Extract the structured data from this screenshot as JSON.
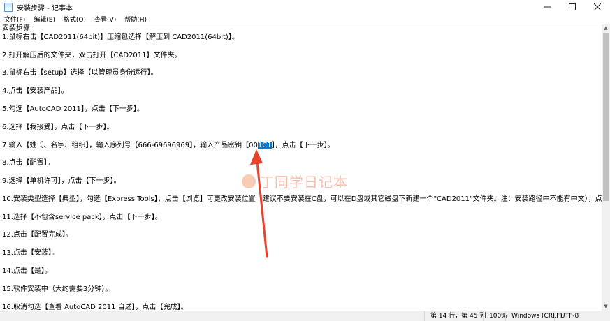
{
  "window": {
    "title": "安装步骤 - 记事本",
    "minimize_icon": "minimize-icon",
    "maximize_icon": "maximize-icon",
    "close_icon": "close-icon"
  },
  "menu": {
    "items": [
      "文件(F)",
      "编辑(E)",
      "格式(O)",
      "查看(V)",
      "帮助(H)"
    ]
  },
  "editor": {
    "lines": [
      "安装步骤",
      "1.鼠标右击【CAD2011(64bit)】压缩包选择【解压到 CAD2011(64bit)】。",
      "",
      "2.打开解压后的文件夹，双击打开【CAD2011】文件夹。",
      "",
      "3.鼠标右击【setup】选择【以管理员身份运行】。",
      "",
      "4.点击【安装产品】。",
      "",
      "5.勾选【AutoCAD 2011】，点击【下一步】。",
      "",
      "6.选择【我接受】，点击【下一步】。",
      "",
      "7.输入【姓氏、名字、组织】，输入序列号【666-69696969】，输入产品密钥【001C1】，点击【下一步】。",
      "",
      "8.点击【配置】。",
      "",
      "9.选择【单机许可】，点击【下一步】。",
      "",
      "10.安装类型选择【典型】，勾选【Express Tools】，点击【浏览】可更改安装位置（建议不要安装在C盘，可以在D盘或其它磁盘下新建一个\"CAD2011\"文件夹。注：安装路径中不能有中文），点",
      "",
      "11.选择【不包含service pack】，点击【下一步】。",
      "",
      "12.点击【配置完成】。",
      "",
      "13.点击【安装】。",
      "",
      "14.点击【是】。",
      "",
      "15.软件安装中（大约需要3分钟）。",
      "",
      "16.取消勾选【查看 AutoCAD 2011 自述】，点击【完成】。"
    ],
    "selected_line_index": 13,
    "selection": {
      "before": "7.输入【姓氏、名字、组织】，输入序列号【666-69696969】，输入产品密钥【00",
      "selected": "1C1",
      "after": "】，点击【下一步】。"
    }
  },
  "watermark": {
    "text": "丁同学日记本"
  },
  "annotation": {
    "arrow_color": "#e8412c"
  },
  "statusbar": {
    "position": "第 14 行，第 45 列",
    "zoom": "100%",
    "line_ending": "Windows (CRLF)",
    "encoding": "UTF-8"
  },
  "colors": {
    "selection": "#0078d7",
    "statusbar_bg": "#f0f0f0"
  }
}
